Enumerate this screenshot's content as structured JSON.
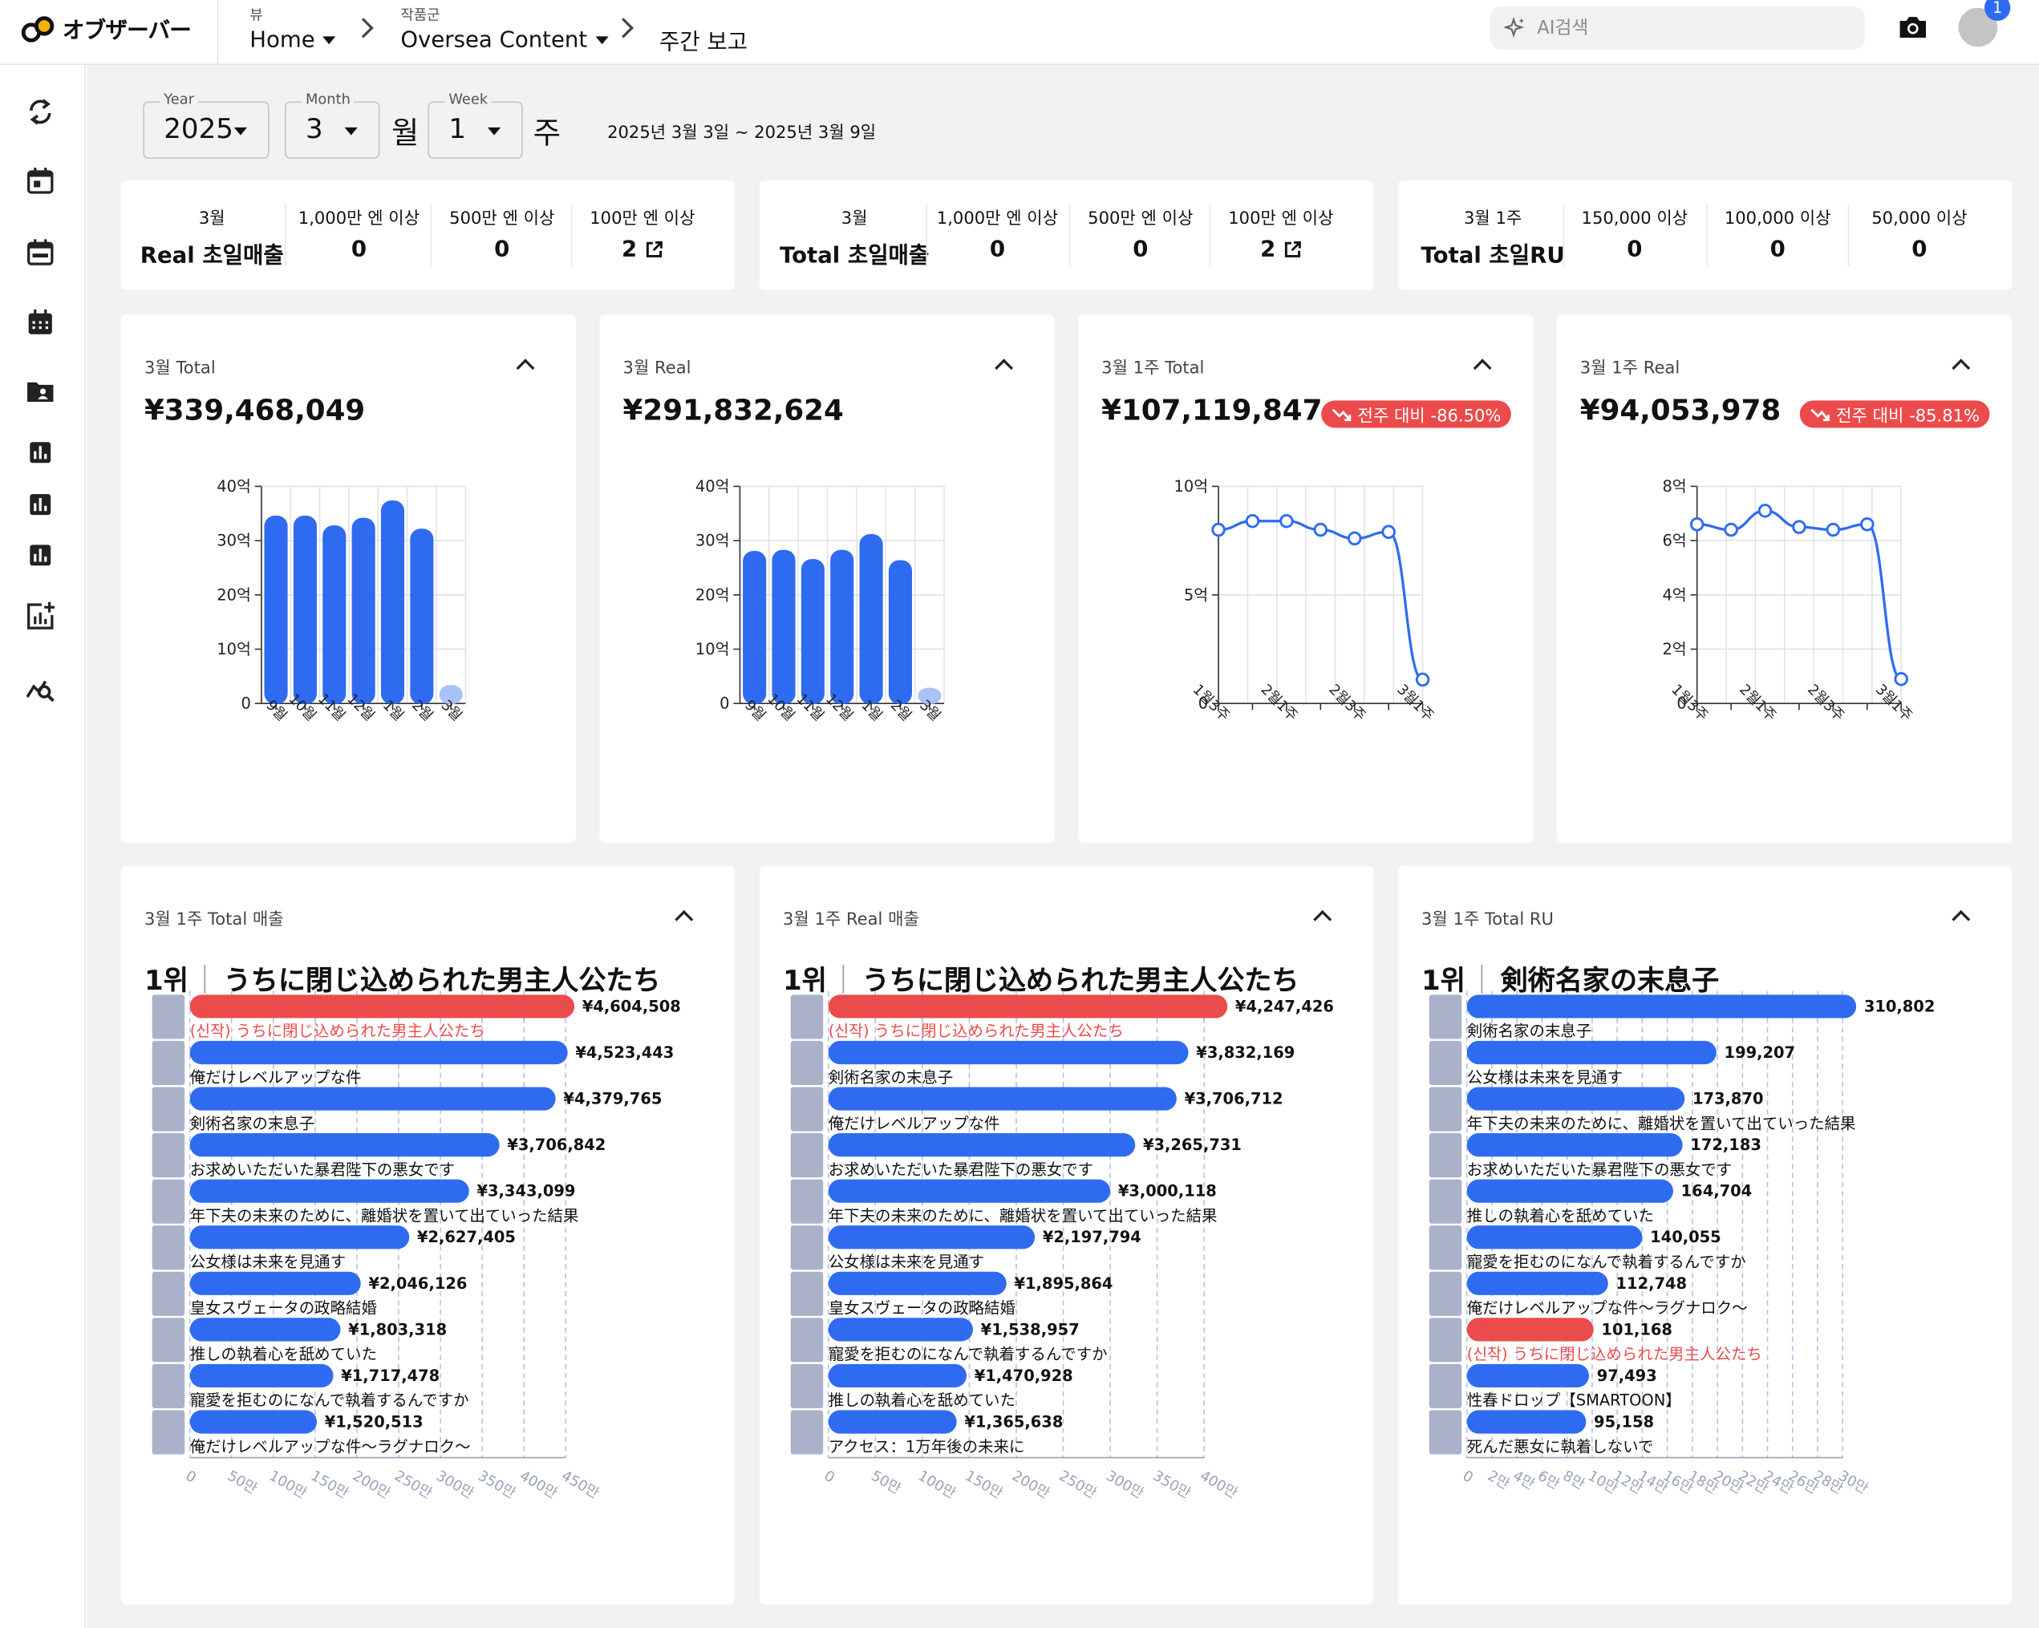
{
  "header": {
    "logo_text": "オブザーバー",
    "view_caption": "뷰",
    "view_value": "Home",
    "group_caption": "작품군",
    "group_value": "Oversea Content",
    "page_title": "주간 보고",
    "search_placeholder": "AI검색",
    "notification_count": "1"
  },
  "sidebar": {
    "items": [
      "refresh-icon",
      "calendar-day-icon",
      "calendar-week-icon",
      "calendar-month-icon",
      "folder-user-icon",
      "bar-chart-icon",
      "bar-chart-icon",
      "bar-chart-icon",
      "chart-add-icon",
      "chart-search-icon"
    ]
  },
  "filters": {
    "year_label": "Year",
    "year_value": "2025",
    "month_label": "Month",
    "month_value": "3",
    "month_unit": "월",
    "week_label": "Week",
    "week_value": "1",
    "week_unit": "주",
    "date_range": "2025년 3월 3일 ~ 2025년 3월 9일"
  },
  "kpis": [
    {
      "title_line1": "3월",
      "title_line2": "Real 초일매출",
      "cells": [
        {
          "label": "1,000만 엔 이상",
          "value": "0"
        },
        {
          "label": "500만 엔 이상",
          "value": "0"
        },
        {
          "label": "100만 엔 이상",
          "value": "2",
          "link": true
        }
      ]
    },
    {
      "title_line1": "3월",
      "title_line2": "Total 초일매출",
      "cells": [
        {
          "label": "1,000만 엔 이상",
          "value": "0"
        },
        {
          "label": "500만 엔 이상",
          "value": "0"
        },
        {
          "label": "100만 엔 이상",
          "value": "2",
          "link": true
        }
      ]
    },
    {
      "title_line1": "3월 1주",
      "title_line2": "Total 초일RU",
      "cells": [
        {
          "label": "150,000 이상",
          "value": "0"
        },
        {
          "label": "100,000 이상",
          "value": "0"
        },
        {
          "label": "50,000 이상",
          "value": "0"
        }
      ]
    }
  ],
  "summary_cards": [
    {
      "title": "3월 Total",
      "value": "¥339,468,049"
    },
    {
      "title": "3월 Real",
      "value": "¥291,832,624"
    },
    {
      "title": "3월 1주 Total",
      "value": "¥107,119,847",
      "badge": "전주 대비 -86.50%"
    },
    {
      "title": "3월 1주 Real",
      "value": "¥94,053,978",
      "badge": "전주 대비 -85.81%"
    }
  ],
  "rank_cards": [
    {
      "title": "3월 1주 Total 매출",
      "rank_label": "1위",
      "rank_title": "うちに閉じ込められた男主人公たち"
    },
    {
      "title": "3월 1주 Real 매출",
      "rank_label": "1위",
      "rank_title": "うちに閉じ込められた男主人公たち"
    },
    {
      "title": "3월 1주 Total RU",
      "rank_label": "1위",
      "rank_title": "剣術名家の末息子"
    }
  ],
  "colors": {
    "primary": "#2f6bf0",
    "highlight": "#ec4b4b",
    "faded": "#a9c2f7"
  },
  "chart_data": [
    {
      "type": "bar",
      "title": "3월 Total",
      "unit": "억",
      "categories": [
        "9월",
        "10월",
        "11월",
        "12월",
        "1월",
        "2월",
        "3월"
      ],
      "values": [
        34.6,
        34.6,
        32.8,
        34.2,
        37.4,
        32.2,
        3.4
      ],
      "yticks": [
        "0",
        "10억",
        "20억",
        "30억",
        "40억"
      ],
      "ylim": [
        0,
        40
      ]
    },
    {
      "type": "bar",
      "title": "3월 Real",
      "unit": "억",
      "categories": [
        "9월",
        "10월",
        "11월",
        "12월",
        "1월",
        "2월",
        "3월"
      ],
      "values": [
        28.1,
        28.3,
        26.6,
        28.3,
        31.2,
        26.4,
        2.9
      ],
      "yticks": [
        "0",
        "10억",
        "20억",
        "30억",
        "40억"
      ],
      "ylim": [
        0,
        40
      ]
    },
    {
      "type": "line",
      "title": "3월 1주 Total",
      "unit": "억",
      "categories": [
        "1월3주",
        "1월4주",
        "2월1주",
        "2월2주",
        "2월3주",
        "2월4주",
        "3월1주"
      ],
      "xtick_labels": [
        "1월3주",
        "2월1주",
        "2월3주",
        "3월1주"
      ],
      "values": [
        8.0,
        8.4,
        8.4,
        8.0,
        7.6,
        7.9,
        1.1
      ],
      "yticks": [
        "0",
        "5억",
        "10억"
      ],
      "ylim": [
        0,
        10
      ]
    },
    {
      "type": "line",
      "title": "3월 1주 Real",
      "unit": "억",
      "categories": [
        "1월3주",
        "1월4주",
        "2월1주",
        "2월2주",
        "2월3주",
        "2월4주",
        "3월1주"
      ],
      "xtick_labels": [
        "1월3주",
        "2월1주",
        "2월3주",
        "3월1주"
      ],
      "values": [
        6.6,
        6.4,
        7.1,
        6.5,
        6.4,
        6.6,
        0.9
      ],
      "yticks": [
        "0",
        "2억",
        "4억",
        "6억",
        "8억"
      ],
      "ylim": [
        0,
        8
      ]
    },
    {
      "type": "bar",
      "orientation": "horizontal",
      "title": "3월 1주 Total 매출",
      "xticks": [
        "0",
        "50만",
        "100만",
        "150만",
        "200만",
        "250만",
        "300만",
        "350만",
        "400만",
        "450만"
      ],
      "xlim": [
        0,
        4500000
      ],
      "items": [
        {
          "label": "(신작) うちに閉じ込められた男主人公たち",
          "value": 4604508,
          "value_label": "¥4,604,508",
          "highlight": true
        },
        {
          "label": "俺だけレベルアップな件",
          "value": 4523443,
          "value_label": "¥4,523,443"
        },
        {
          "label": "剣術名家の末息子",
          "value": 4379765,
          "value_label": "¥4,379,765"
        },
        {
          "label": "お求めいただいた暴君陛下の悪女です",
          "value": 3706842,
          "value_label": "¥3,706,842"
        },
        {
          "label": "年下夫の未来のために、離婚状を置いて出ていった結果",
          "value": 3343099,
          "value_label": "¥3,343,099"
        },
        {
          "label": "公女様は未来を見通す",
          "value": 2627405,
          "value_label": "¥2,627,405"
        },
        {
          "label": "皇女スヴェータの政略結婚",
          "value": 2046126,
          "value_label": "¥2,046,126"
        },
        {
          "label": "推しの執着心を舐めていた",
          "value": 1803318,
          "value_label": "¥1,803,318"
        },
        {
          "label": "寵愛を拒むのになんで執着するんですか",
          "value": 1717478,
          "value_label": "¥1,717,478"
        },
        {
          "label": "俺だけレベルアップな件～ラグナロク～",
          "value": 1520513,
          "value_label": "¥1,520,513"
        }
      ]
    },
    {
      "type": "bar",
      "orientation": "horizontal",
      "title": "3월 1주 Real 매출",
      "xticks": [
        "0",
        "50만",
        "100만",
        "150만",
        "200만",
        "250만",
        "300만",
        "350만",
        "400만"
      ],
      "xlim": [
        0,
        4000000
      ],
      "items": [
        {
          "label": "(신작) うちに閉じ込められた男主人公たち",
          "value": 4247426,
          "value_label": "¥4,247,426",
          "highlight": true
        },
        {
          "label": "剣術名家の末息子",
          "value": 3832169,
          "value_label": "¥3,832,169"
        },
        {
          "label": "俺だけレベルアップな件",
          "value": 3706712,
          "value_label": "¥3,706,712"
        },
        {
          "label": "お求めいただいた暴君陛下の悪女です",
          "value": 3265731,
          "value_label": "¥3,265,731"
        },
        {
          "label": "年下夫の未来のために、離婚状を置いて出ていった結果",
          "value": 3000118,
          "value_label": "¥3,000,118"
        },
        {
          "label": "公女様は未来を見通す",
          "value": 2197794,
          "value_label": "¥2,197,794"
        },
        {
          "label": "皇女スヴェータの政略結婚",
          "value": 1895864,
          "value_label": "¥1,895,864"
        },
        {
          "label": "寵愛を拒むのになんで執着するんですか",
          "value": 1538957,
          "value_label": "¥1,538,957"
        },
        {
          "label": "推しの執着心を舐めていた",
          "value": 1470928,
          "value_label": "¥1,470,928"
        },
        {
          "label": "アクセス：1万年後の未来に",
          "value": 1365638,
          "value_label": "¥1,365,638"
        }
      ]
    },
    {
      "type": "bar",
      "orientation": "horizontal",
      "title": "3월 1주 Total RU",
      "xticks": [
        "0",
        "2만",
        "4만",
        "6만",
        "8만",
        "10만",
        "12만",
        "14만",
        "16만",
        "18만",
        "20만",
        "22만",
        "24만",
        "26만",
        "28만",
        "30만"
      ],
      "xlim": [
        0,
        300000
      ],
      "items": [
        {
          "label": "剣術名家の末息子",
          "value": 310802,
          "value_label": "310,802"
        },
        {
          "label": "公女様は未来を見通す",
          "value": 199207,
          "value_label": "199,207"
        },
        {
          "label": "年下夫の未来のために、離婚状を置いて出ていった結果",
          "value": 173870,
          "value_label": "173,870"
        },
        {
          "label": "お求めいただいた暴君陛下の悪女です",
          "value": 172183,
          "value_label": "172,183"
        },
        {
          "label": "推しの執着心を舐めていた",
          "value": 164704,
          "value_label": "164,704"
        },
        {
          "label": "寵愛を拒むのになんで執着するんですか",
          "value": 140055,
          "value_label": "140,055"
        },
        {
          "label": "俺だけレベルアップな件～ラグナロク～",
          "value": 112748,
          "value_label": "112,748"
        },
        {
          "label": "(신작) うちに閉じ込められた男主人公たち",
          "value": 101168,
          "value_label": "101,168",
          "highlight": true
        },
        {
          "label": "性春ドロップ【SMARTOON】",
          "value": 97493,
          "value_label": "97,493"
        },
        {
          "label": "死んだ悪女に執着しないで",
          "value": 95158,
          "value_label": "95,158"
        }
      ]
    }
  ]
}
